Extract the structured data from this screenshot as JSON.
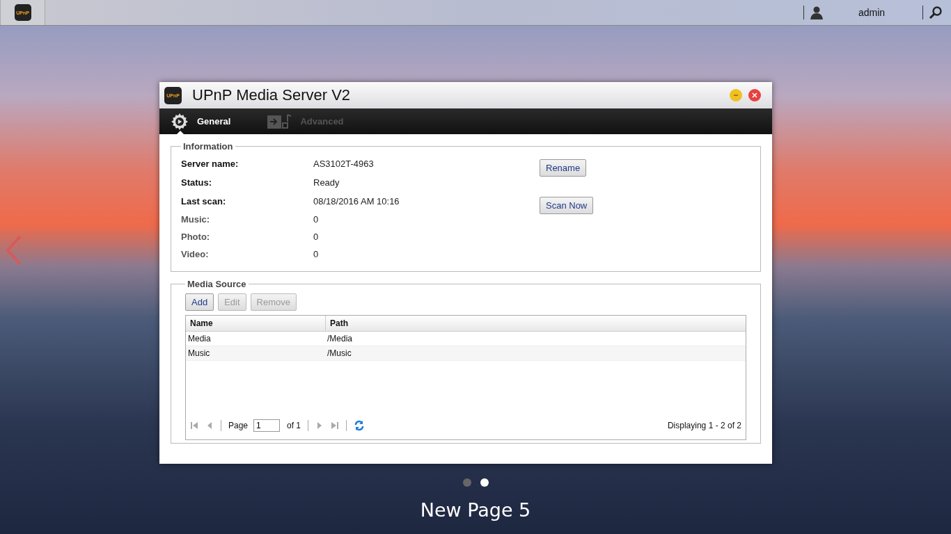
{
  "taskbar": {
    "app_icon_label": "UPnP",
    "user": "admin"
  },
  "window": {
    "title": "UPnP Media Server V2",
    "icon_label": "UPnP"
  },
  "tabs": [
    {
      "label": "General",
      "kind": "gear",
      "selected": true,
      "disabled": false
    },
    {
      "label": "Advanced",
      "kind": "media",
      "selected": false,
      "disabled": true
    }
  ],
  "information": {
    "legend": "Information",
    "fields": [
      {
        "label": "Server name:",
        "value": "AS3102T-4963",
        "strong": true,
        "button": "Rename"
      },
      {
        "label": "Status:",
        "value": "Ready",
        "strong": true
      },
      {
        "label": "Last scan:",
        "value": "08/18/2016 AM 10:16",
        "strong": true,
        "button": "Scan Now"
      },
      {
        "label": "Music:",
        "value": "0",
        "strong": false
      },
      {
        "label": "Photo:",
        "value": "0",
        "strong": false
      },
      {
        "label": "Video:",
        "value": "0",
        "strong": false
      }
    ]
  },
  "media_source": {
    "legend": "Media Source",
    "buttons": [
      {
        "label": "Add",
        "disabled": false
      },
      {
        "label": "Edit",
        "disabled": true
      },
      {
        "label": "Remove",
        "disabled": true
      }
    ],
    "table": {
      "columns": [
        "Name",
        "Path"
      ],
      "rows": [
        [
          "Media",
          "/Media"
        ],
        [
          "Music",
          "/Music"
        ]
      ]
    },
    "pager": {
      "page_label": "Page",
      "page": "1",
      "of": "of 1",
      "display": "Displaying 1 - 2 of 2"
    }
  },
  "desktop": {
    "page_dots": [
      {
        "selected": false
      },
      {
        "selected": true
      }
    ],
    "page_title": "New Page 5"
  }
}
